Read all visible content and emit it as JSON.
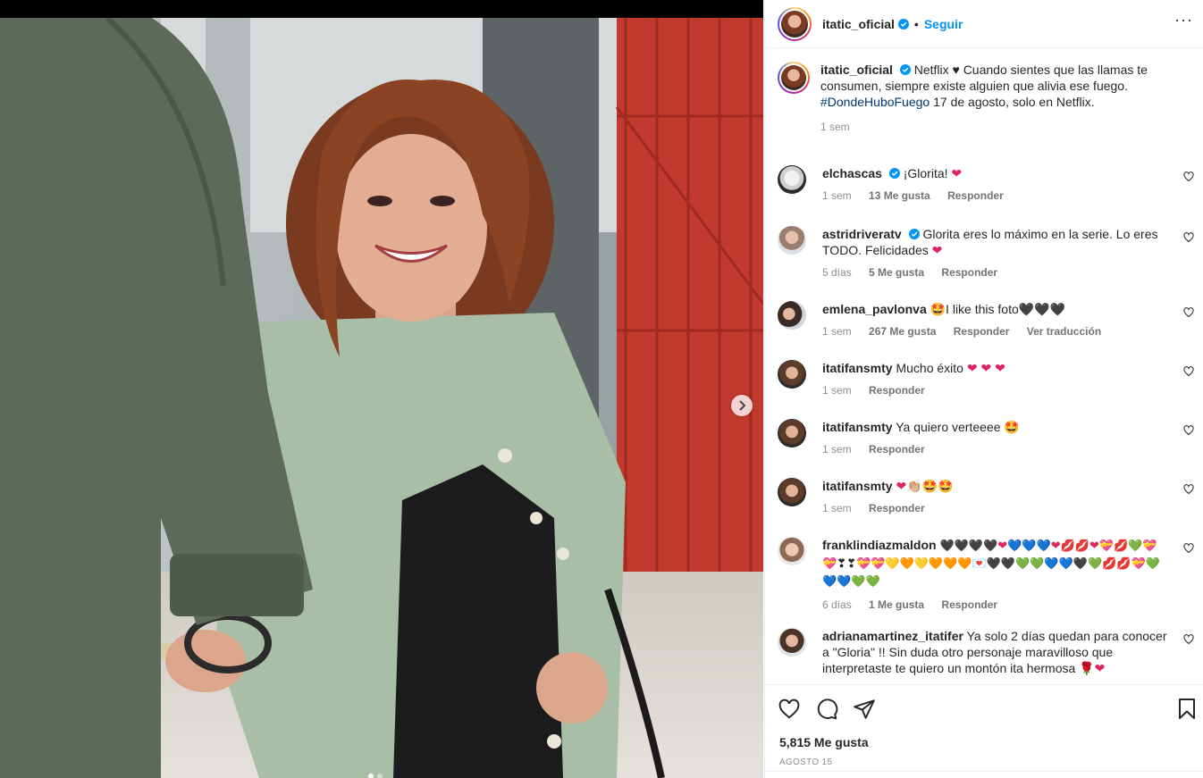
{
  "header": {
    "username": "itatic_oficial",
    "follow_label": "Seguir",
    "bullet": "•",
    "more": "···"
  },
  "caption": {
    "username": "itatic_oficial",
    "text_part1": "Netflix ♥ Cuando sientes que las llamas te consumen, siempre existe alguien que alivia ese fuego. ",
    "hashtag": "#DondeHuboFuego",
    "text_part2": " 17 de agosto, solo en Netflix.",
    "time": "1 sem"
  },
  "comments": [
    {
      "username": "elchascas",
      "verified": true,
      "text": "¡Glorita! ❤",
      "time": "1 sem",
      "likes": "13 Me gusta",
      "reply": "Responder",
      "translate": ""
    },
    {
      "username": "astridriveratv",
      "verified": true,
      "text": "Glorita eres lo máximo en la serie. Lo eres TODO. Felicidades ❤",
      "time": "5 días",
      "likes": "5 Me gusta",
      "reply": "Responder",
      "translate": ""
    },
    {
      "username": "emlena_pavlonva",
      "verified": false,
      "text": "🤩I like this foto🖤🖤🖤",
      "time": "1 sem",
      "likes": "267 Me gusta",
      "reply": "Responder",
      "translate": "Ver traducción"
    },
    {
      "username": "itatifansmty",
      "verified": false,
      "text": "Mucho éxito ❤ ❤ ❤",
      "time": "1 sem",
      "likes": "",
      "reply": "Responder",
      "translate": ""
    },
    {
      "username": "itatifansmty",
      "verified": false,
      "text": "Ya quiero verteeee 🤩",
      "time": "1 sem",
      "likes": "",
      "reply": "Responder",
      "translate": ""
    },
    {
      "username": "itatifansmty",
      "verified": false,
      "text": "❤👏🏼🤩🤩",
      "time": "1 sem",
      "likes": "",
      "reply": "Responder",
      "translate": ""
    },
    {
      "username": "franklindiazmaldon",
      "verified": false,
      "text": "🖤🖤🖤🖤❤💙💙💙❤💋💋❤💝💋💚💝💝❣❣💝💝💛🧡💛🧡🧡🧡💌🖤🖤💚💚💙💙🖤💚💋💋💝💚💙💙💚💚",
      "time": "6 días",
      "likes": "1 Me gusta",
      "reply": "Responder",
      "translate": ""
    },
    {
      "username": "adrianamartinez_itatifer",
      "verified": false,
      "text": "Ya solo 2 días quedan para conocer a \"Gloria\" !! Sin duda otro personaje maravilloso que interpretaste te quiero un montón ita hermosa 🌹❤",
      "time": "",
      "likes": "",
      "reply": "",
      "translate": ""
    }
  ],
  "actions": {
    "like_icon": "heart-outline-icon",
    "comment_icon": "comment-icon",
    "share_icon": "paper-plane-icon",
    "save_icon": "bookmark-icon",
    "likes_count": "5,815 Me gusta",
    "date": "AGOSTO 15"
  },
  "colors": {
    "accent_blue": "#0095f6",
    "hashtag": "#00376b",
    "muted": "#8e8e8e",
    "heart": "#e0245e"
  }
}
